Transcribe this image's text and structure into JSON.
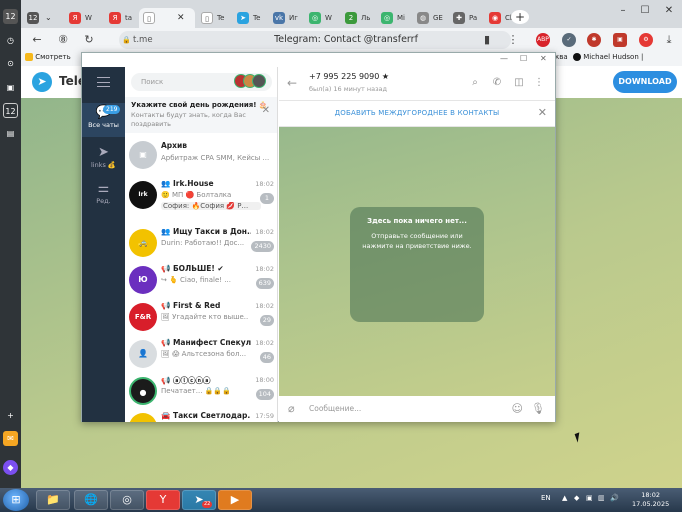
{
  "leftbar": {
    "items": [
      {
        "label": "12",
        "icon": "tab-counter-icon",
        "color": "#555"
      },
      {
        "label": "◷",
        "icon": "history-icon",
        "color": "transparent"
      },
      {
        "label": "⊙",
        "icon": "clock-icon",
        "color": "transparent"
      },
      {
        "label": "▣",
        "icon": "screenshot-icon",
        "color": "transparent"
      },
      {
        "label": "12",
        "icon": "calendar-icon",
        "color": "transparent"
      },
      {
        "label": "▤",
        "icon": "notes-icon",
        "color": "transparent"
      }
    ],
    "bottom": [
      {
        "label": "+",
        "icon": "add-icon"
      },
      {
        "label": "✉",
        "icon": "mail-icon"
      },
      {
        "label": "◆",
        "icon": "alice-icon"
      }
    ]
  },
  "tabs": [
    {
      "label": "12",
      "color": "#555"
    },
    {
      "label": "W",
      "color": "#e53935"
    },
    {
      "label": "ta",
      "color": "#e53935"
    },
    {
      "label": "",
      "color": "#666"
    },
    {
      "label": "Te",
      "color": "#888"
    },
    {
      "label": "Te",
      "color": "#2aa3e0"
    },
    {
      "label": "Иг",
      "color": "#4a76a8"
    },
    {
      "label": "W",
      "color": "#3cb56f"
    },
    {
      "label": "Ль",
      "color": "#3c9a3c"
    },
    {
      "label": "Mi",
      "color": "#3cb56f"
    },
    {
      "label": "GE",
      "color": "#888"
    },
    {
      "label": "Pa",
      "color": "#666"
    },
    {
      "label": "Cb",
      "color": "#e53935"
    }
  ],
  "window_controls": {
    "minimize": "–",
    "maximize": "☐",
    "close": "✕"
  },
  "address": {
    "domain": "t.me",
    "title": "Telegram: Contact @transferrf"
  },
  "extensions": [
    {
      "label": "ABP",
      "color": "#d8232a"
    },
    {
      "label": "✓",
      "color": "#5a6b7a"
    },
    {
      "label": "✱",
      "color": "#c0392b"
    },
    {
      "label": "▣",
      "color": "#c0392b"
    },
    {
      "label": "⚙",
      "color": "#e53935"
    }
  ],
  "bookmarks": {
    "left": "Смотреть",
    "right1": "ква",
    "right2": "Michael Hudson |"
  },
  "page": {
    "brand": "Telegram",
    "download_label": "DOWNLOAD"
  },
  "popup": {
    "rail": {
      "all_chats": "Все чаты",
      "all_chats_badge": "219",
      "links": "links 💰",
      "edit": "Ред."
    },
    "search_placeholder": "Поиск",
    "birthday": {
      "title": "Укажите свой день рождения! 🎂",
      "subtitle": "Контакты будут знать, когда Вас поздравить"
    },
    "chats": [
      {
        "avatar": "▣",
        "color": "#c7ccd1",
        "name": "Архив",
        "time": "",
        "msg": "Арбитраж CPA SMM, Кейсы ...",
        "msg2": "",
        "badge": ""
      },
      {
        "avatar": "Irk",
        "color": "#111111",
        "name": "👥 Irk.House",
        "time": "18:02",
        "msg": "🙂 МП   🔴 Болталка",
        "msg2": "София: 🔥София 💋 Р...",
        "badge": "1"
      },
      {
        "avatar": "🚕",
        "color": "#f2c200",
        "name": "👥 Ищу Такси в Дон...",
        "time": "18:02",
        "msg": "Durin: Работаю!! Дос...",
        "msg2": "",
        "badge": "2430"
      },
      {
        "avatar": "Ю",
        "color": "#6b2fbf",
        "name": "📢 БОЛЬШЕ! ✔",
        "time": "18:02",
        "msg": "↪ 🫰 Ciao, finale! ...",
        "msg2": "",
        "badge": "639"
      },
      {
        "avatar": "F&R",
        "color": "#d81e2a",
        "name": "📢 First & Red",
        "time": "18:02",
        "msg": "🖼 Угадайте кто выше...",
        "msg2": "",
        "badge": "29"
      },
      {
        "avatar": "👤",
        "color": "#d9dde0",
        "name": "📢 Манифест Спекул...",
        "time": "18:02",
        "msg": "🖼 😱 Альтсезона бол...",
        "msg2": "",
        "badge": "46"
      },
      {
        "avatar": "●",
        "color": "#1b1b1b",
        "name": "📢 ⓐⓛⓒⓝⓐ",
        "time": "18:00",
        "msg": "Печатает... 🔒🔒🔒",
        "msg2": "",
        "badge": "104"
      },
      {
        "avatar": "🚕",
        "color": "#f2c200",
        "name": "🚘 Такси Светлодар...",
        "time": "17:59",
        "msg": "",
        "msg2": "",
        "badge": ""
      }
    ],
    "chat": {
      "phone": "+7 995 225 9090 ★",
      "status": "был(а) 16 минут назад",
      "add_contact": "ДОБАВИТЬ МЕЖДУГОРОДНЕЕ В КОНТАКТЫ",
      "empty_title": "Здесь пока ничего нет...",
      "empty_text": "Отправьте сообщение или нажмите на приветствие ниже.",
      "input_placeholder": "Сообщение..."
    }
  },
  "taskbar": {
    "lang": "EN",
    "time": "18:02",
    "date": "17.05.2025",
    "telegram_badge": "22"
  }
}
